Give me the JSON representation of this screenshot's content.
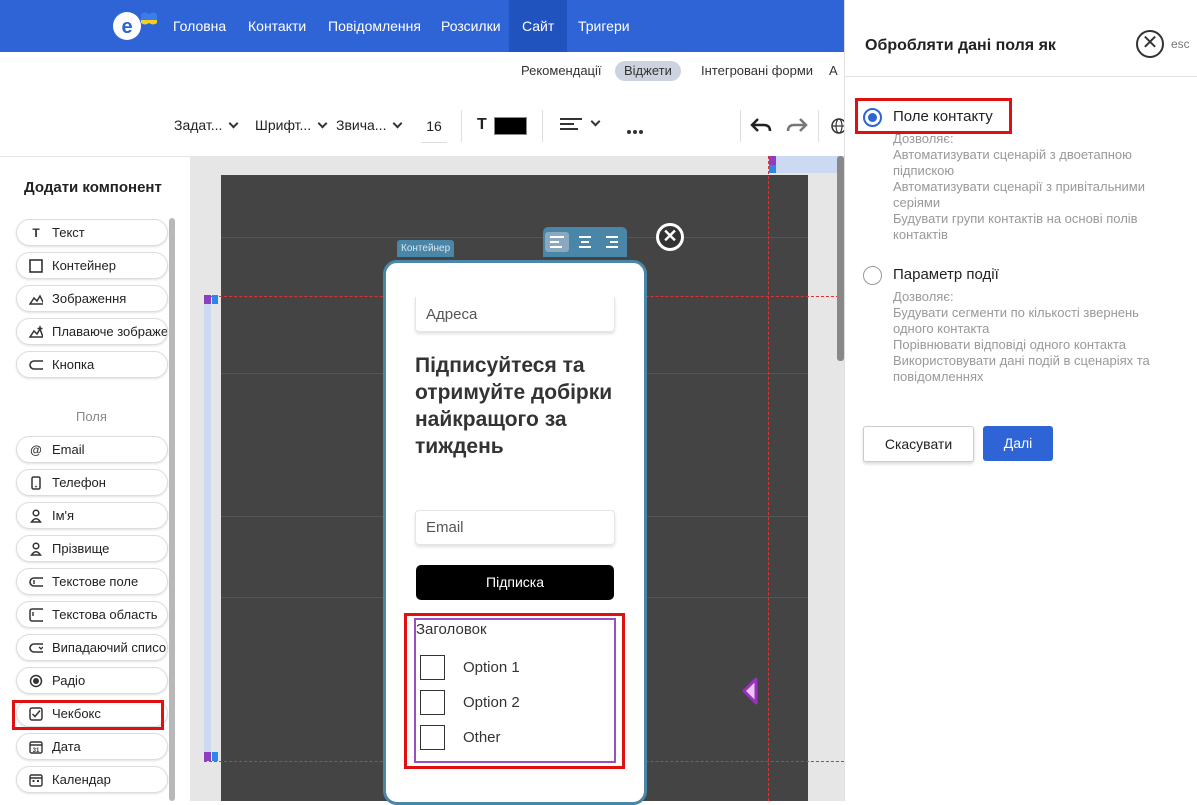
{
  "topnav": {
    "items": [
      "Головна",
      "Контакти",
      "Повідомлення",
      "Розсилки",
      "Сайт",
      "Тригери"
    ],
    "active": "Сайт"
  },
  "subnav": {
    "items": [
      "Рекомендації",
      "Віджети",
      "Інтегровані форми",
      "А"
    ],
    "active": "Віджети"
  },
  "toolbar": {
    "preset": "Задат...",
    "font": "Шрифт...",
    "weight": "Звича...",
    "size": "16",
    "text_color_label": "T",
    "text_color": "#000000"
  },
  "left_panel": {
    "title": "Додати компонент",
    "components": [
      "Текст",
      "Контейнер",
      "Зображення",
      "Плаваюче зображення",
      "Кнопка"
    ],
    "fields_label": "Поля",
    "fields": [
      "Email",
      "Телефон",
      "Ім'я",
      "Прізвище",
      "Текстове поле",
      "Текстова область",
      "Випадаючий список",
      "Радіо",
      "Чекбокс",
      "Дата",
      "Календар"
    ]
  },
  "canvas": {
    "container_tag": "Контейнер",
    "close_glyph": "✕",
    "address_placeholder": "Адреса",
    "heading": "Підписуйтеся та отримуйте добірки найкращого за тиждень",
    "email_placeholder": "Email",
    "subscribe_button": "Підписка",
    "checkbox_title": "Заголовок",
    "options": [
      "Option 1",
      "Option 2",
      "Other"
    ]
  },
  "right_panel": {
    "title": "Обробляти дані поля як",
    "esc": "esc",
    "option1": {
      "label": "Поле контакту",
      "selected": true,
      "desc": [
        "Дозволяє:",
        "Автоматизувати сценарій з двоетапною підпискою",
        "Автоматизувати сценарії з привітальними серіями",
        "Будувати групи контактів на основі полів контактів"
      ]
    },
    "option2": {
      "label": "Параметр події",
      "selected": false,
      "desc": [
        "Дозволяє:",
        "Будувати сегменти по кількості звернень одного контакта",
        "Порівнювати відповіді одного контакта",
        "Використовувати дані подій в сценаріях та повідомленнях"
      ]
    },
    "cancel": "Скасувати",
    "next": "Далі"
  },
  "colors": {
    "brand": "#2e64d6",
    "highlight": "#e01010",
    "selection": "#9a4fc0"
  }
}
